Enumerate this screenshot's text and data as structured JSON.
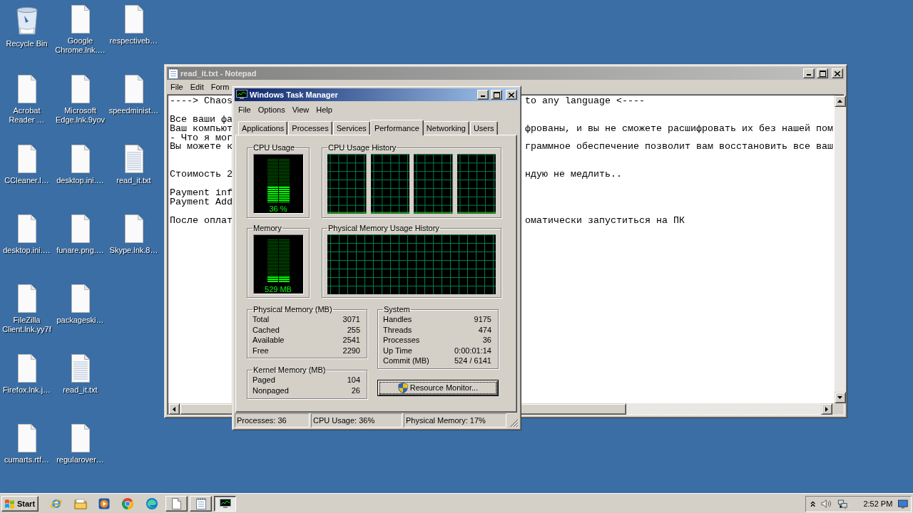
{
  "desktop": {
    "icons": [
      {
        "label": "Recycle Bin",
        "kind": "recycle-bin"
      },
      {
        "label": "Acrobat Reader …",
        "kind": "file"
      },
      {
        "label": "CCleaner.l…",
        "kind": "file"
      },
      {
        "label": "desktop.ini.…",
        "kind": "file"
      },
      {
        "label": "FileZilla Client.lnk.yy7f",
        "kind": "file"
      },
      {
        "label": "Firefox.lnk.j…",
        "kind": "file"
      },
      {
        "label": "cumarts.rtf…",
        "kind": "file"
      },
      {
        "label": "Google Chrome.lnk.…",
        "kind": "file"
      },
      {
        "label": "Microsoft Edge.lnk.9yov",
        "kind": "file"
      },
      {
        "label": "desktop.ini.…",
        "kind": "file"
      },
      {
        "label": "funare.png.…",
        "kind": "file"
      },
      {
        "label": "packageski…",
        "kind": "file"
      },
      {
        "label": "read_it.txt",
        "kind": "text-file"
      },
      {
        "label": "regularover…",
        "kind": "file"
      },
      {
        "label": "respectiveb…",
        "kind": "file"
      },
      {
        "label": "speedminist…",
        "kind": "file"
      },
      {
        "label": "read_it.txt",
        "kind": "text-file"
      },
      {
        "label": "Skype.lnk.8…",
        "kind": "file"
      }
    ]
  },
  "notepad": {
    "title": "read_it.txt - Notepad",
    "active": false,
    "menu": [
      "File",
      "Edit",
      "Form"
    ],
    "lines": [
      {
        "kind": "text",
        "left": "----> Chaos",
        "right": "to any language <----"
      },
      {
        "kind": "blank"
      },
      {
        "kind": "text",
        "left": "Все ваши фа"
      },
      {
        "kind": "text",
        "left": "Ваш компьют",
        "right": "фрованы, и вы не сможете расшифровать их без нашей пом"
      },
      {
        "kind": "text",
        "left": "- Что я мог"
      },
      {
        "kind": "text",
        "left": "Вы можете к",
        "right": "граммное обеспечение позволит вам восстановить все ваш"
      },
      {
        "kind": "blank"
      },
      {
        "kind": "blank"
      },
      {
        "kind": "text",
        "left": "Стоимость 2",
        "right": "ндую не медлить.."
      },
      {
        "kind": "blank"
      },
      {
        "kind": "text",
        "left": "Payment inf"
      },
      {
        "kind": "text",
        "left": "Payment Add"
      },
      {
        "kind": "blank"
      },
      {
        "kind": "text",
        "left": "После оплат",
        "right": "оматически запуститься на ПК"
      }
    ]
  },
  "task_manager": {
    "title": "Windows Task Manager",
    "active": true,
    "menu": [
      "File",
      "Options",
      "View",
      "Help"
    ],
    "tabs": [
      {
        "label": "Applications",
        "selected": false
      },
      {
        "label": "Processes",
        "selected": false
      },
      {
        "label": "Services",
        "selected": false
      },
      {
        "label": "Performance",
        "selected": true
      },
      {
        "label": "Networking",
        "selected": false
      },
      {
        "label": "Users",
        "selected": false
      }
    ],
    "cpu_usage": {
      "label": "CPU Usage",
      "reading": "36 %",
      "level": 0.36
    },
    "cpu_history": {
      "label": "CPU Usage History"
    },
    "memory": {
      "label": "Memory",
      "reading": "529 MB",
      "level": 0.15
    },
    "memory_history": {
      "label": "Physical Memory Usage History"
    },
    "physical_memory": {
      "label": "Physical Memory (MB)",
      "rows": [
        {
          "label": "Total",
          "value": "3071"
        },
        {
          "label": "Cached",
          "value": "255"
        },
        {
          "label": "Available",
          "value": "2541"
        },
        {
          "label": "Free",
          "value": "2290"
        }
      ]
    },
    "kernel_memory": {
      "label": "Kernel Memory (MB)",
      "rows": [
        {
          "label": "Paged",
          "value": "104"
        },
        {
          "label": "Nonpaged",
          "value": "26"
        }
      ]
    },
    "system": {
      "label": "System",
      "rows": [
        {
          "label": "Handles",
          "value": "9175"
        },
        {
          "label": "Threads",
          "value": "474"
        },
        {
          "label": "Processes",
          "value": "36"
        },
        {
          "label": "Up Time",
          "value": "0:00:01:14"
        },
        {
          "label": "Commit (MB)",
          "value": "524 / 6141"
        }
      ]
    },
    "resource_monitor_button": "Resource Monitor...",
    "status_bar": [
      "Processes: 36",
      "CPU Usage: 36%",
      "Physical Memory: 17%"
    ]
  },
  "taskbar": {
    "start": "Start",
    "tasks": [
      {
        "selected": false
      },
      {
        "selected": false
      },
      {
        "selected": true
      }
    ],
    "clock": "2:52 PM"
  }
}
